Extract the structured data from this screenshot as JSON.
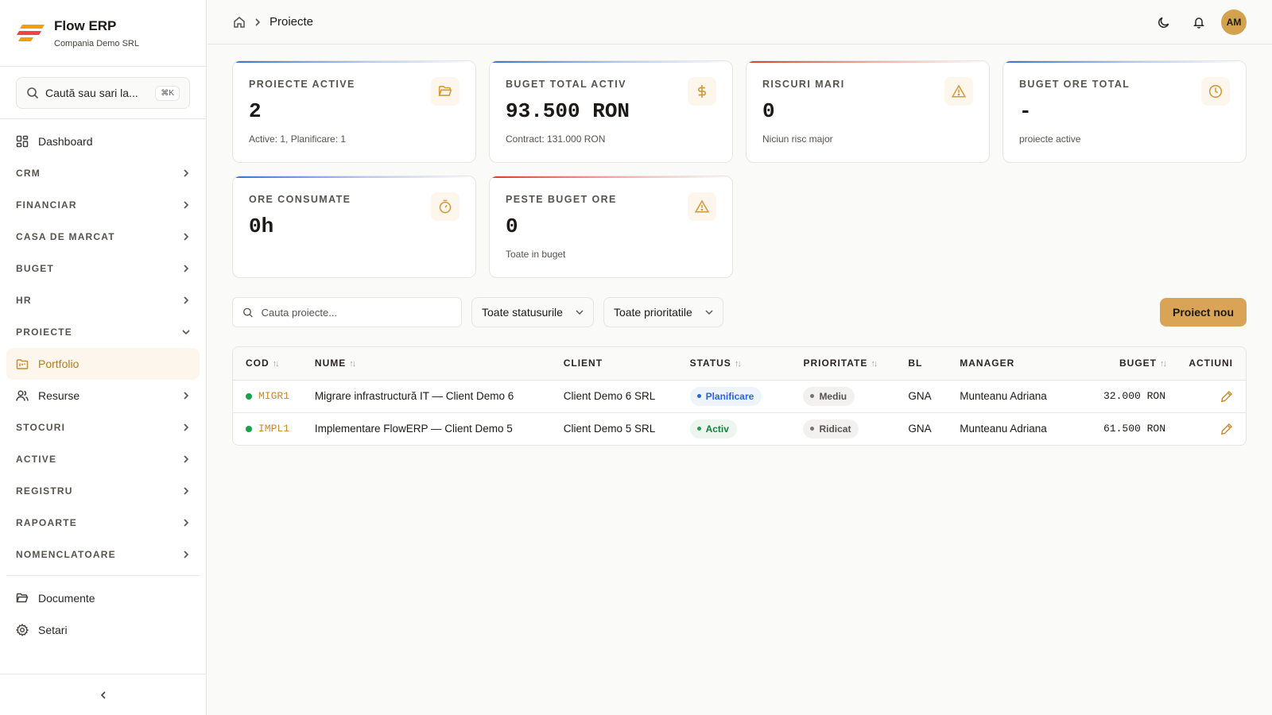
{
  "app": {
    "name": "Flow ERP",
    "company": "Compania Demo SRL"
  },
  "sidebar": {
    "search_label": "Caută sau sari la...",
    "search_shortcut": "⌘K",
    "dashboard": "Dashboard",
    "sections": [
      "CRM",
      "FINANCIAR",
      "CASA DE MARCAT",
      "BUGET",
      "HR"
    ],
    "projects_section": "PROIECTE",
    "projects_children": {
      "portfolio": "Portfolio",
      "resources": "Resurse"
    },
    "sections_after": [
      "STOCURI",
      "ACTIVE",
      "REGISTRU",
      "RAPOARTE",
      "NOMENCLATOARE"
    ],
    "bottom": {
      "documents": "Documente",
      "settings": "Setari"
    }
  },
  "topbar": {
    "breadcrumb_current": "Proiecte",
    "avatar_initials": "AM"
  },
  "cards": [
    {
      "label": "PROIECTE ACTIVE",
      "value": "2",
      "sub": "Active: 1, Planificare: 1",
      "icon": "folder-open-icon",
      "accent": "blue"
    },
    {
      "label": "BUGET TOTAL ACTIV",
      "value": "93.500 RON",
      "sub": "Contract: 131.000 RON",
      "icon": "dollar-icon",
      "accent": "blue"
    },
    {
      "label": "RISCURI MARI",
      "value": "0",
      "sub": "Niciun risc major",
      "icon": "alert-triangle-icon",
      "accent": "red"
    },
    {
      "label": "BUGET ORE TOTAL",
      "value": "-",
      "sub": "proiecte active",
      "icon": "clock-icon",
      "accent": "blue"
    },
    {
      "label": "ORE CONSUMATE",
      "value": "0h",
      "sub": "",
      "icon": "timer-icon",
      "accent": "blue"
    },
    {
      "label": "PESTE BUGET ORE",
      "value": "0",
      "sub": "Toate in buget",
      "icon": "alert-triangle-icon",
      "accent": "red"
    }
  ],
  "toolbar": {
    "search_placeholder": "Cauta proiecte...",
    "status_filter": "Toate statusurile",
    "priority_filter": "Toate prioritatile",
    "new_project": "Proiect nou"
  },
  "table": {
    "headers": {
      "cod": "COD",
      "nume": "NUME",
      "client": "CLIENT",
      "status": "STATUS",
      "prioritate": "PRIORITATE",
      "bl": "BL",
      "manager": "MANAGER",
      "buget": "BUGET",
      "actiuni": "ACTIUNI"
    },
    "rows": [
      {
        "cod": "MIGR1",
        "nume": "Migrare infrastructură IT — Client Demo 6",
        "client": "Client Demo 6 SRL",
        "status": "Planificare",
        "prioritate": "Mediu",
        "bl": "GNA",
        "manager": "Munteanu Adriana",
        "buget": "32.000 RON"
      },
      {
        "cod": "IMPL1",
        "nume": "Implementare FlowERP — Client Demo 5",
        "client": "Client Demo 5 SRL",
        "status": "Activ",
        "prioritate": "Ridicat",
        "bl": "GNA",
        "manager": "Munteanu Adriana",
        "buget": "61.500 RON"
      }
    ]
  },
  "colors": {
    "brand_accent": "#d9a455",
    "accent_blue": "#3b6fd4",
    "accent_red": "#dc3b2f",
    "status_active": "#16a34a"
  }
}
